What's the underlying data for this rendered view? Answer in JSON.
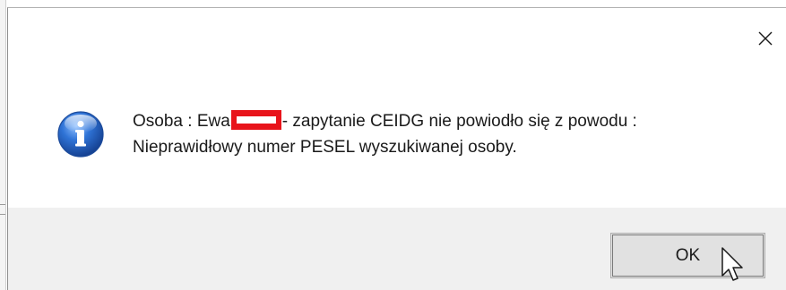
{
  "dialog": {
    "close_glyph": "✕",
    "message_prefix": "Osoba : Ewa",
    "message_suffix": "- zapytanie CEIDG nie powiodło się z powodu :",
    "message_line2": "Nieprawidłowy numer PESEL wyszukiwanej osoby.",
    "ok_label": "OK"
  },
  "icons": {
    "close": "close-icon",
    "info": "info-icon",
    "cursor": "mouse-pointer-icon"
  },
  "colors": {
    "footer_background": "#f0f0f0",
    "redaction": "#e8141b",
    "button_background": "#e1e1e1",
    "info_icon_blue": "#1f5fbf"
  }
}
